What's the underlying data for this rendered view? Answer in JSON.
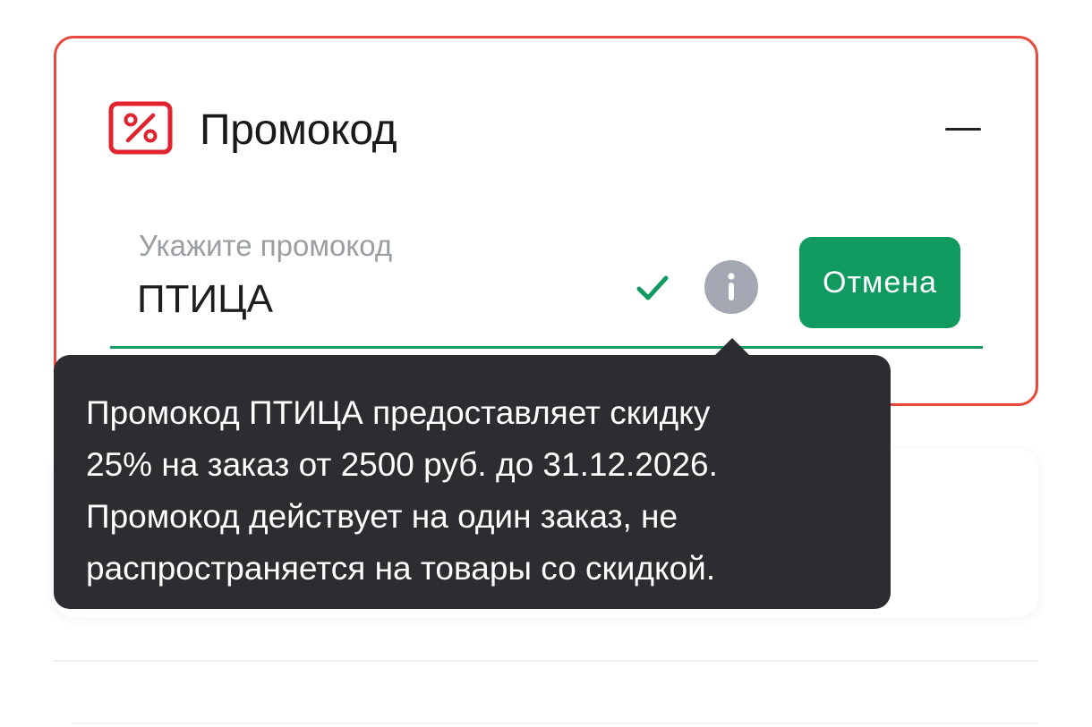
{
  "promo": {
    "title": "Промокод",
    "input_label": "Укажите промокод",
    "input_value": "ПТИЦА",
    "cancel_label": "Отмена",
    "status": "valid"
  },
  "tooltip": {
    "lines": [
      "Промокод ПТИЦА предоставляет скидку",
      "25% на заказ от 2500 руб. до 31.12.2026.",
      "Промокод действует на один заказ, не",
      "распространяется на товары со скидкой."
    ]
  },
  "colors": {
    "card_border": "#e8473c",
    "accent_green": "#119a5f",
    "info_gray": "#a3a8b3",
    "tooltip_bg": "#2b2d30",
    "label_gray": "#9a9ea3"
  },
  "icons": {
    "promo": "percent-icon",
    "collapse": "minus-icon",
    "valid": "check-icon",
    "info": "info-icon"
  }
}
